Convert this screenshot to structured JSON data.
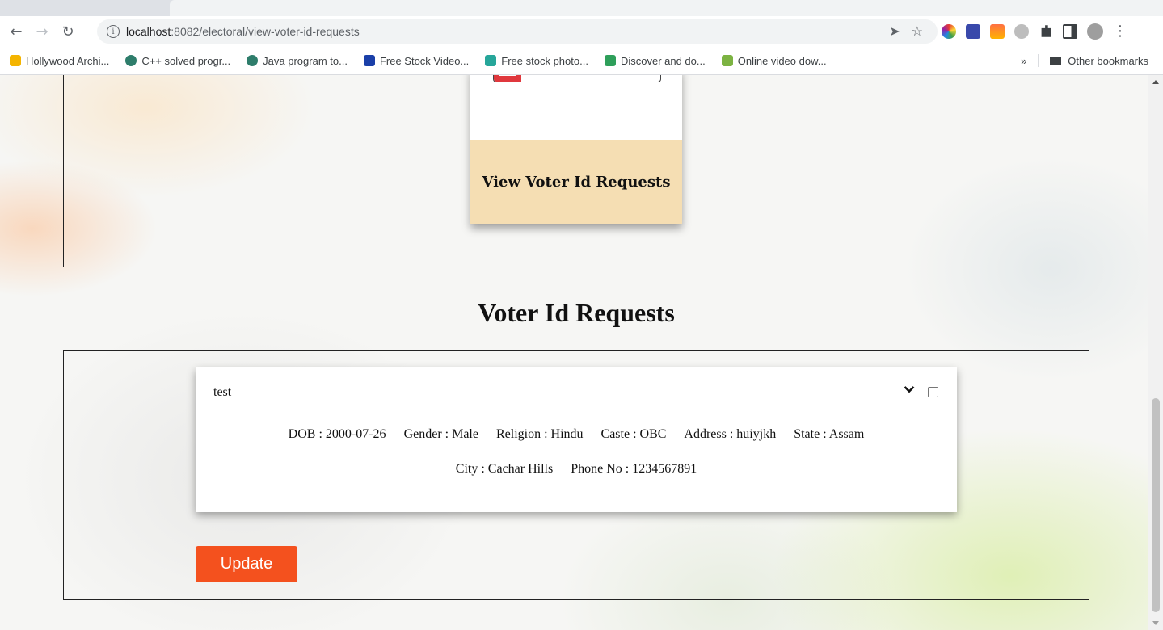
{
  "browser": {
    "url_host": "localhost",
    "url_path": ":8082/electoral/view-voter-id-requests",
    "bookmarks": [
      {
        "label": "Hollywood Archi...",
        "color": "#f4b400"
      },
      {
        "label": "C++ solved progr...",
        "color": "#2e7d6b"
      },
      {
        "label": "Java program to...",
        "color": "#2e7d6b"
      },
      {
        "label": "Free Stock Video...",
        "color": "#1a3fa8"
      },
      {
        "label": "Free stock photo...",
        "color": "#26a69a"
      },
      {
        "label": "Discover and do...",
        "color": "#2e9f5a"
      },
      {
        "label": "Online video dow...",
        "color": "#7cb342"
      }
    ],
    "overflow_label": "»",
    "other_bookmarks": "Other bookmarks"
  },
  "top_card": {
    "label": "View Voter Id Requests"
  },
  "page": {
    "heading": "Voter Id Requests"
  },
  "request": {
    "name": "test",
    "row1": [
      "DOB : 2000-07-26",
      "Gender : Male",
      "Religion : Hindu",
      "Caste : OBC",
      "Address : huiyjkh",
      "State : Assam"
    ],
    "row2": [
      "City : Cachar Hills",
      "Phone No : 1234567891"
    ]
  },
  "actions": {
    "update_label": "Update"
  },
  "colors": {
    "accent": "#f4511e",
    "card_footer": "#f5deb3"
  }
}
